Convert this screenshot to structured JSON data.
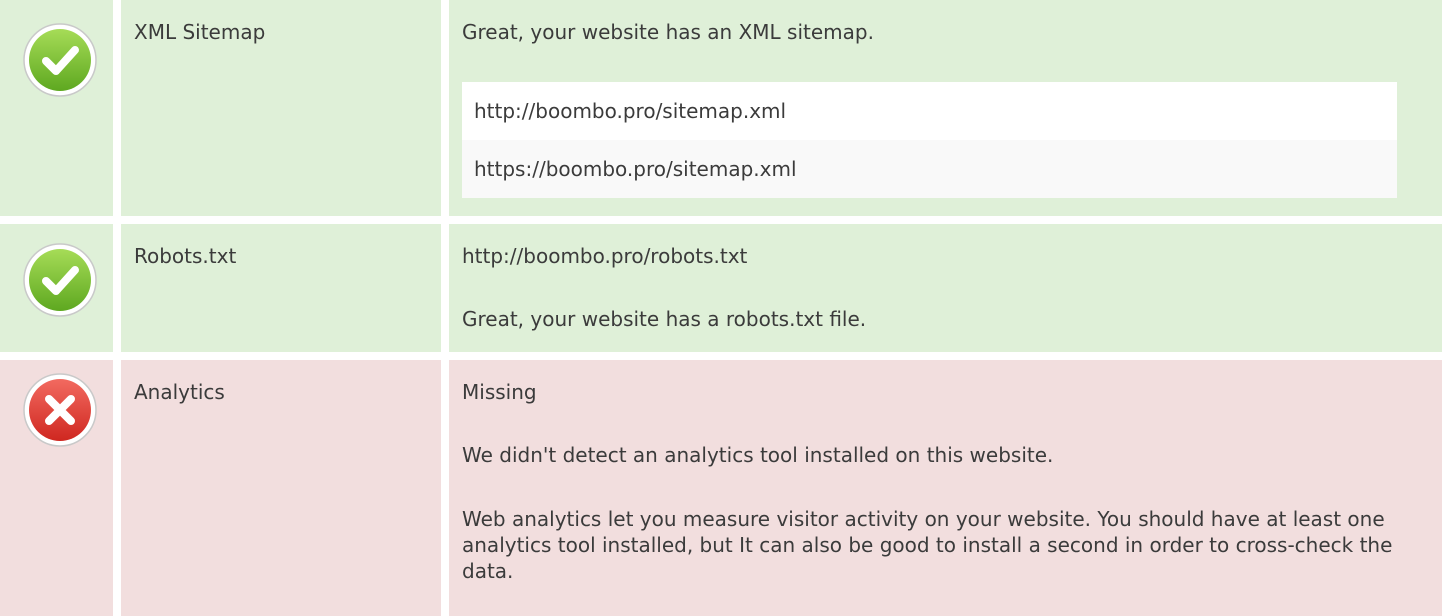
{
  "rows": [
    {
      "status": "ok",
      "icon": "check-circle-icon",
      "name": "XML Sitemap",
      "message": "Great, your website has an XML sitemap.",
      "urls": [
        "http://boombo.pro/sitemap.xml",
        "https://boombo.pro/sitemap.xml"
      ]
    },
    {
      "status": "ok",
      "icon": "check-circle-icon",
      "name": "Robots.txt",
      "url": "http://boombo.pro/robots.txt",
      "message": "Great, your website has a robots.txt file."
    },
    {
      "status": "error",
      "icon": "error-circle-icon",
      "name": "Analytics",
      "state": "Missing",
      "message": "We didn't detect an analytics tool installed on this website.",
      "advice": "Web analytics let you measure visitor activity on your website. You should have at least one analytics tool installed, but It can also be good to install a second in order to cross-check the data."
    }
  ],
  "colors": {
    "ok_bg": "#dff0d8",
    "error_bg": "#f2dede",
    "ok_icon": "#7cc234",
    "error_icon": "#e2413b"
  }
}
